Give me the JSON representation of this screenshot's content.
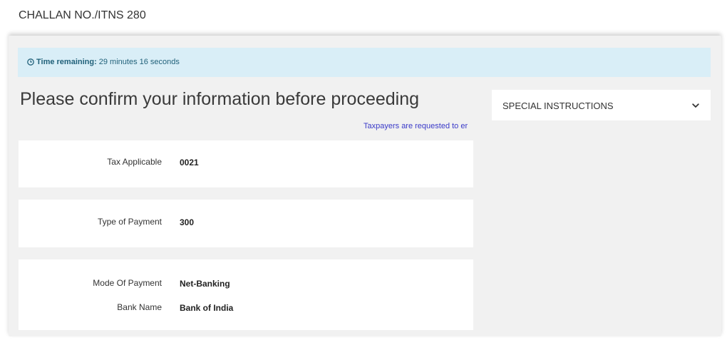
{
  "header": {
    "title": "CHALLAN NO./ITNS 280"
  },
  "timer": {
    "label": "Time remaining:",
    "value": "29 minutes 16 seconds"
  },
  "page": {
    "heading": "Please confirm your information before proceeding",
    "notice": "Taxpayers are requested to er"
  },
  "details": {
    "tax_applicable": {
      "label": "Tax Applicable",
      "value": "0021"
    },
    "type_of_payment": {
      "label": "Type of Payment",
      "value": "300"
    },
    "mode_of_payment": {
      "label": "Mode Of Payment",
      "value": "Net-Banking"
    },
    "bank_name": {
      "label": "Bank Name",
      "value": "Bank of India"
    }
  },
  "special_instructions": {
    "label": "SPECIAL INSTRUCTIONS",
    "icon": "chevron-down-icon"
  },
  "colors": {
    "timer_bg": "#d9eef7",
    "timer_text": "#21617a",
    "notice_text": "#3a3ac8",
    "panel_bg": "#f1f1f1"
  }
}
